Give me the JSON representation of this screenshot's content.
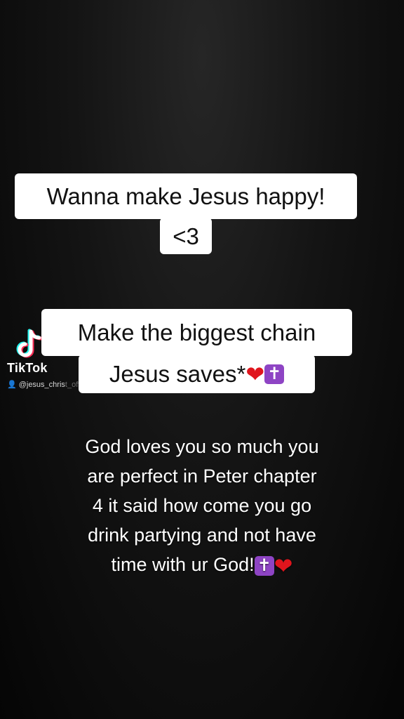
{
  "caption1": {
    "line1": "Wanna make Jesus happy!",
    "line2": "<3"
  },
  "caption2": {
    "line1": "Make the biggest chain",
    "line2_text": "Jesus saves*",
    "line2_emojis": [
      "heart-emoji",
      "latin-cross-emoji"
    ]
  },
  "watermark": {
    "brand": "TikTok",
    "logo_icon": "tiktok-note-icon",
    "user_icon": "person-icon",
    "username_visible": "@jesus_chris",
    "username_blurred": "t_official"
  },
  "message": {
    "lines": [
      "God loves you so much you",
      "are perfect in Peter chapter",
      "4 it said how come you go",
      "drink partying and not have",
      "time with ur God!"
    ],
    "trailing_emojis": [
      "latin-cross-emoji",
      "heart-emoji"
    ]
  },
  "glyphs": {
    "heart": "❤",
    "cross": "✝",
    "person": "👤"
  },
  "colors": {
    "caption_background": "#ffffff",
    "caption_text": "#111111",
    "heart": "#e0151d",
    "cross_square": "#8e44c4",
    "tiktok_cyan": "#25f4ee",
    "tiktok_red": "#fe2c55"
  }
}
